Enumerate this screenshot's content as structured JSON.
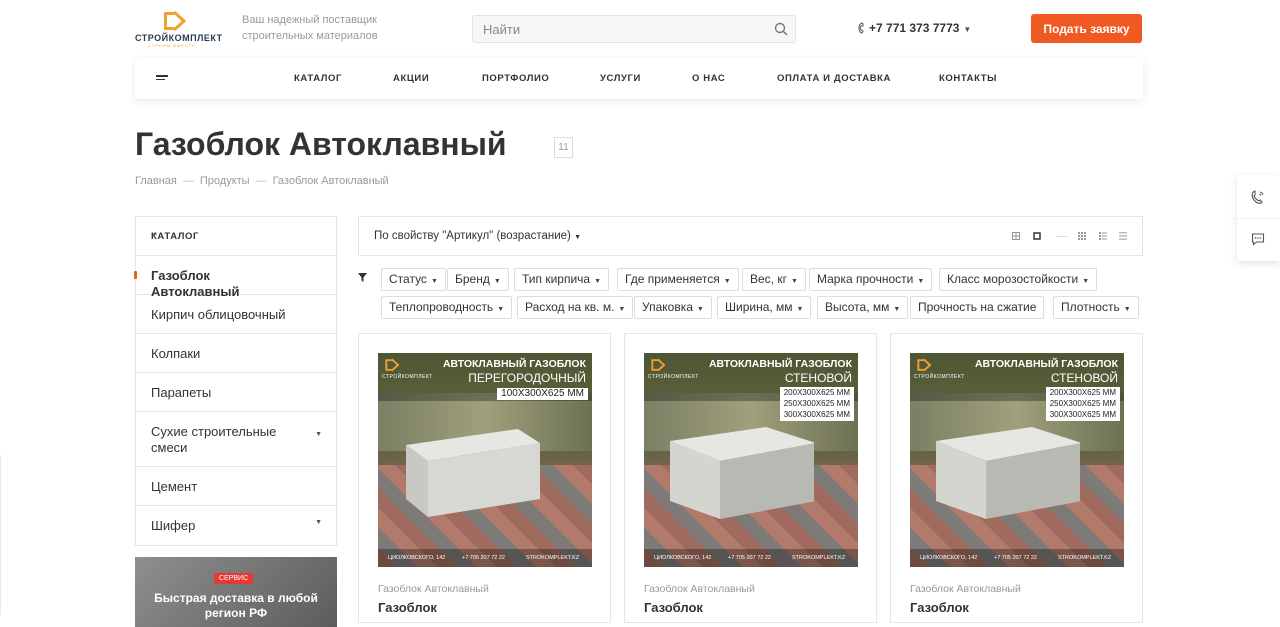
{
  "header": {
    "logo_text": "СТРОЙКОМПЛЕКТ",
    "logo_sub": "СТРОИМ ВМЕСТЕ",
    "tagline": "Ваш надежный поставщик строительных материалов",
    "search_placeholder": "Найти",
    "phone": "+7 771 373 7773",
    "cta_label": "Подать заявку",
    "accent_color": "#f05a22"
  },
  "nav": {
    "items": [
      "КАТАЛОГ",
      "АКЦИИ",
      "ПОРТФОЛИО",
      "УСЛУГИ",
      "О НАС",
      "ОПЛАТА И ДОСТАВКА",
      "КОНТАКТЫ"
    ]
  },
  "page": {
    "title": "Газоблок Автоклавный",
    "count": "11",
    "breadcrumbs": [
      "Главная",
      "Продукты",
      "Газоблок Автоклавный"
    ]
  },
  "sidebar": {
    "title": "КАТАЛОГ",
    "items": [
      {
        "label": "Газоблок Автоклавный",
        "active": true
      },
      {
        "label": "Кирпич облицовочный"
      },
      {
        "label": "Колпаки"
      },
      {
        "label": "Парапеты"
      },
      {
        "label": "Сухие строительные смеси",
        "has_children": true
      },
      {
        "label": "Цемент"
      },
      {
        "label": "Шифер",
        "has_children": true
      }
    ],
    "banner": {
      "tag": "СЕРВИС",
      "text": "Быстрая доставка в любой регион РФ"
    }
  },
  "sorting": {
    "label": "По свойству \"Артикул\" (возрастание)"
  },
  "filters": [
    "Статус",
    "Бренд",
    "Тип кирпича",
    "Где применяется",
    "Вес, кг",
    "Марка прочности",
    "Класс морозостойкости",
    "Теплопроводность",
    "Расход на кв. м.",
    "Упаковка",
    "Ширина, мм",
    "Высота, мм",
    "Прочность на сжатие",
    "Плотность"
  ],
  "products": [
    {
      "category": "Газоблок Автоклавный",
      "name": "Газоблок",
      "image": {
        "title": "АВТОКЛАВНЫЙ ГАЗОБЛОК",
        "subtitle": "ПЕРЕГОРОДОЧНЫЙ",
        "sizes": [
          "100Х300Х625 ММ"
        ],
        "footer": [
          "ЦИОЛКОВСКОГО, 142",
          "+7 705 207 72 22",
          "STROKOMPLEKT.KZ"
        ]
      }
    },
    {
      "category": "Газоблок Автоклавный",
      "name": "Газоблок",
      "image": {
        "title": "АВТОКЛАВНЫЙ ГАЗОБЛОК",
        "subtitle": "СТЕНОВОЙ",
        "sizes": [
          "200Х300Х625 ММ",
          "250Х300Х625 ММ",
          "300Х300Х625 ММ"
        ],
        "footer": [
          "ЦИОЛКОВСКОГО, 142",
          "+7 705 207 72 22",
          "STROKOMPLEKT.KZ"
        ]
      }
    },
    {
      "category": "Газоблок Автоклавный",
      "name": "Газоблок",
      "image": {
        "title": "АВТОКЛАВНЫЙ ГАЗОБЛОК",
        "subtitle": "СТЕНОВОЙ",
        "sizes": [
          "200Х300Х625 ММ",
          "250Х300Х625 ММ",
          "300Х300Х625 ММ"
        ],
        "footer": [
          "ЦИОЛКОВСКОГО, 142",
          "+7 705 207 72 22",
          "STROKOMPLEKT.KZ"
        ]
      }
    }
  ]
}
